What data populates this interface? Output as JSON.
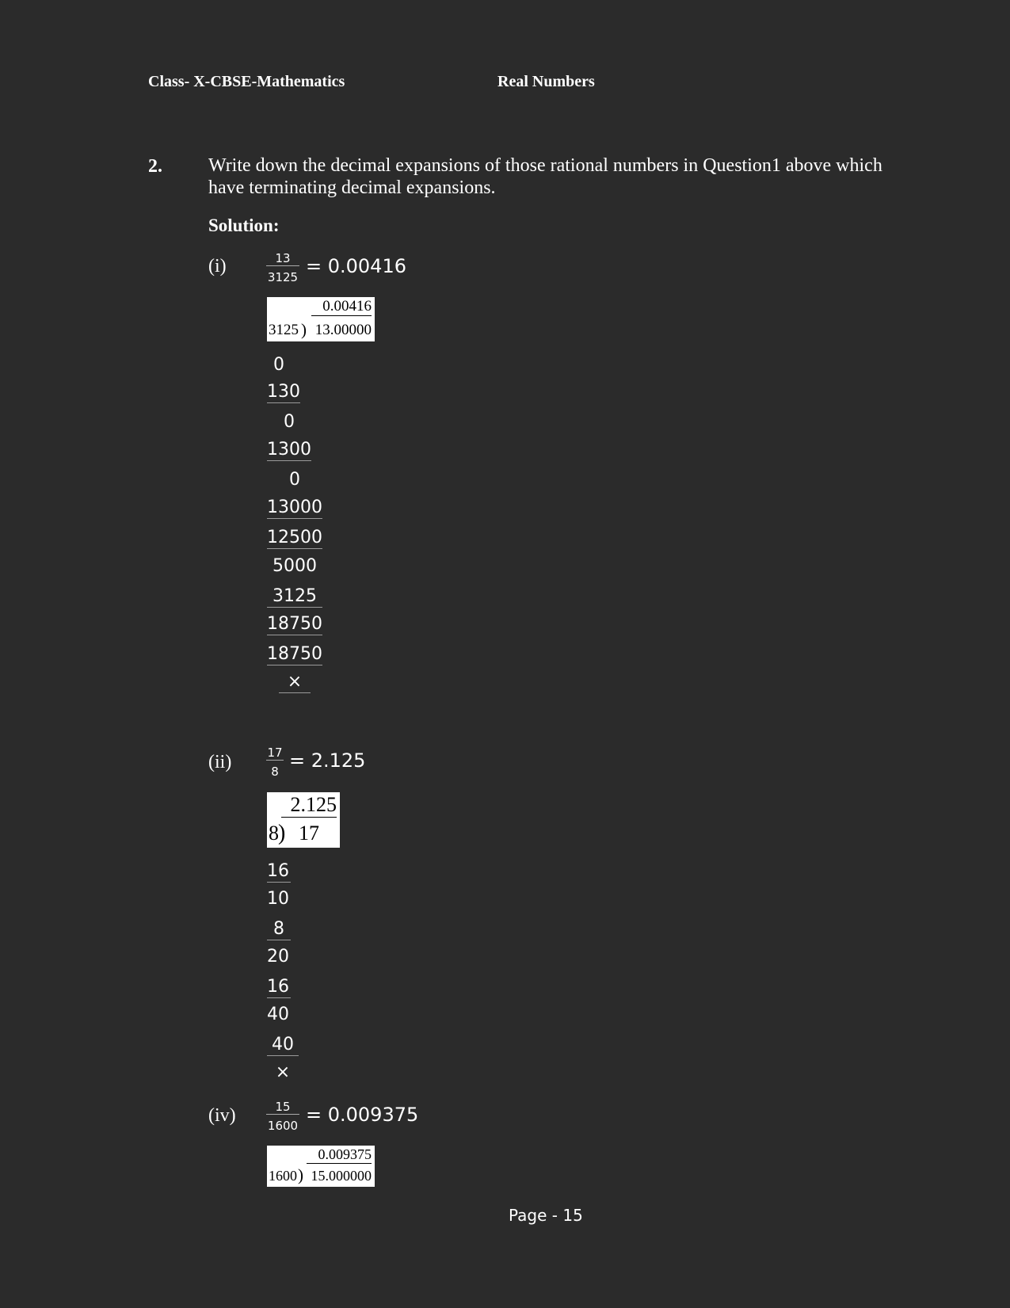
{
  "header": {
    "left": "Class- X-CBSE-Mathematics",
    "right": "Real Numbers"
  },
  "question": {
    "number": "2.",
    "text": "Write down the decimal expansions of those rational numbers in Question1 above which have terminating decimal expansions.",
    "solution_label": "Solution:"
  },
  "parts": [
    {
      "label": "(i)",
      "numerator": "13",
      "denominator": "3125",
      "result": "= 0.00416",
      "division": {
        "quotient": "0.00416",
        "divisor": "3125",
        "dividend": "13.00000"
      },
      "steps": [
        "0",
        "130",
        "0",
        "1300",
        "0",
        "13000",
        "12500",
        "5000",
        "3125",
        "18750",
        "18750",
        "×"
      ]
    },
    {
      "label": "(ii)",
      "numerator": "17",
      "denominator": "8",
      "result": "= 2.125",
      "division": {
        "quotient": "2.125",
        "divisor": "8",
        "dividend": "17"
      },
      "steps": [
        "16",
        "10",
        "8",
        "20",
        "16",
        "40",
        "40",
        "×"
      ]
    },
    {
      "label": "(iv)",
      "numerator": "15",
      "denominator": "1600",
      "result": "= 0.009375",
      "division": {
        "quotient": "0.009375",
        "divisor": "1600",
        "dividend": "15.000000"
      }
    }
  ],
  "footer": {
    "page": "Page - 15"
  }
}
